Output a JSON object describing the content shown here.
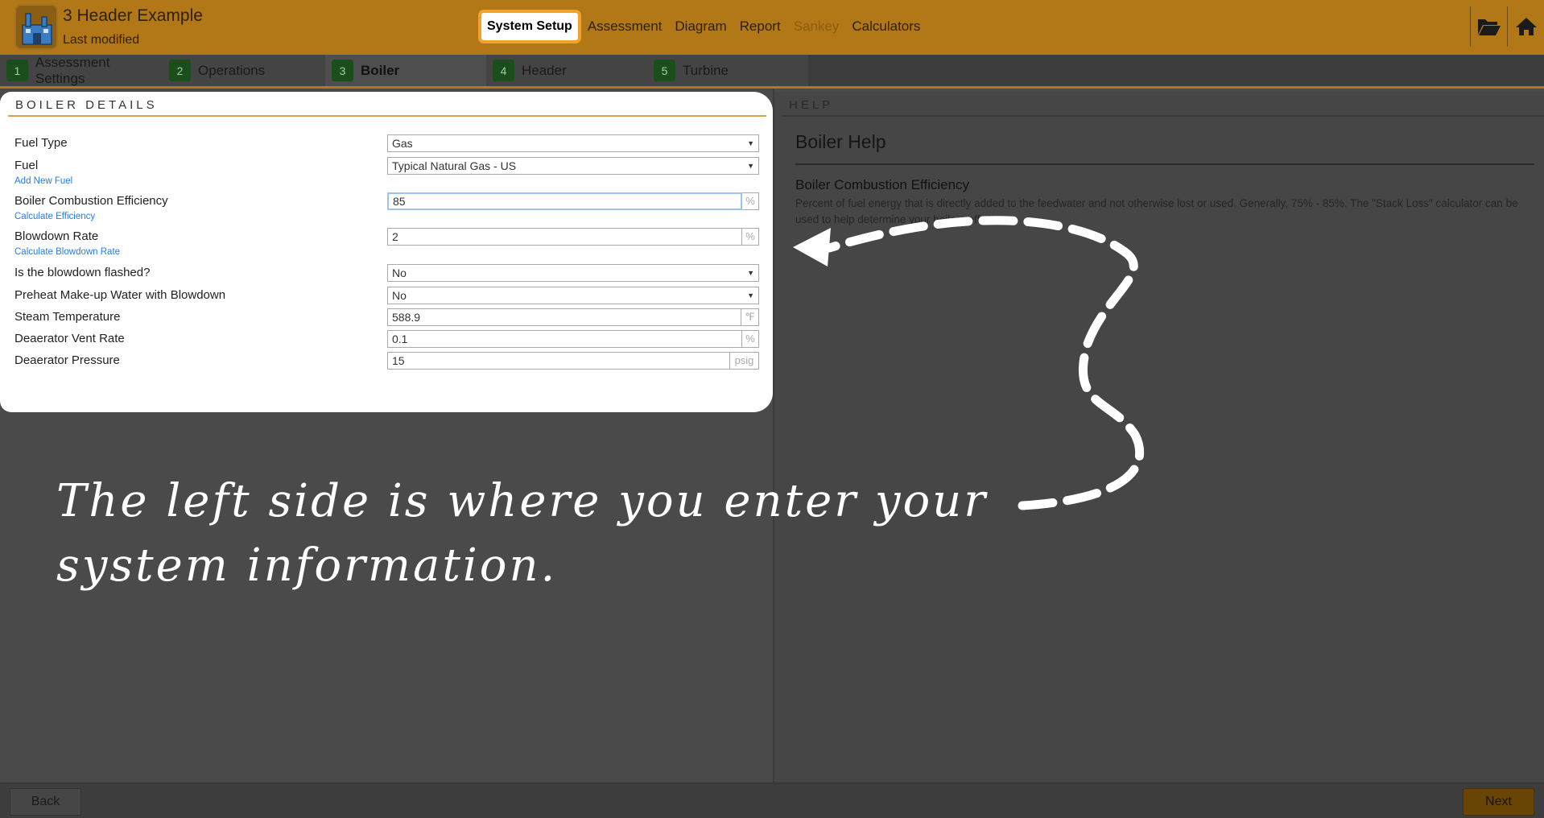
{
  "header": {
    "title": "3 Header Example",
    "subtitle": "Last modified",
    "nav": [
      {
        "label": "System Setup",
        "state": "active"
      },
      {
        "label": "Assessment",
        "state": "normal"
      },
      {
        "label": "Diagram",
        "state": "normal"
      },
      {
        "label": "Report",
        "state": "normal"
      },
      {
        "label": "Sankey",
        "state": "disabled"
      },
      {
        "label": "Calculators",
        "state": "normal"
      }
    ],
    "icons": [
      "folder-open-icon",
      "home-icon"
    ]
  },
  "steps": [
    {
      "num": "1",
      "label": "Assessment Settings"
    },
    {
      "num": "2",
      "label": "Operations"
    },
    {
      "num": "3",
      "label": "Boiler"
    },
    {
      "num": "4",
      "label": "Header"
    },
    {
      "num": "5",
      "label": "Turbine"
    }
  ],
  "active_step": "3",
  "boiler": {
    "title": "BOILER DETAILS",
    "fields": {
      "fuel_type": {
        "label": "Fuel Type",
        "value": "Gas"
      },
      "fuel": {
        "label": "Fuel",
        "value": "Typical Natural Gas - US",
        "link": "Add New Fuel"
      },
      "efficiency": {
        "label": "Boiler Combustion Efficiency",
        "value": "85",
        "unit": "%",
        "link": "Calculate Efficiency"
      },
      "blowdown_rate": {
        "label": "Blowdown Rate",
        "value": "2",
        "unit": "%",
        "link": "Calculate Blowdown Rate"
      },
      "blowdown_flashed": {
        "label": "Is the blowdown flashed?",
        "value": "No"
      },
      "preheat": {
        "label": "Preheat Make-up Water with Blowdown",
        "value": "No"
      },
      "steam_temp": {
        "label": "Steam Temperature",
        "value": "588.9",
        "unit": "℉"
      },
      "vent_rate": {
        "label": "Deaerator Vent Rate",
        "value": "0.1",
        "unit": "%"
      },
      "deaerator_pressure": {
        "label": "Deaerator Pressure",
        "value": "15",
        "unit": "psig"
      }
    }
  },
  "help": {
    "heading": "HELP",
    "title": "Boiler Help",
    "subtitle": "Boiler Combustion Efficiency",
    "text": "Percent of fuel energy that is directly added to the feedwater and not otherwise lost or used. Generally, 75% - 85%. The \"Stack Loss\" calculator can be used to help determine your boilers efficiency."
  },
  "footer": {
    "back": "Back",
    "next": "Next"
  },
  "annotation": {
    "line1": "The left side is where you enter your",
    "line2": "system information."
  },
  "colors": {
    "header": "#b27716",
    "accent": "#f2a22a",
    "link": "#2a7be0",
    "step_badge": "#1c4d1c"
  }
}
